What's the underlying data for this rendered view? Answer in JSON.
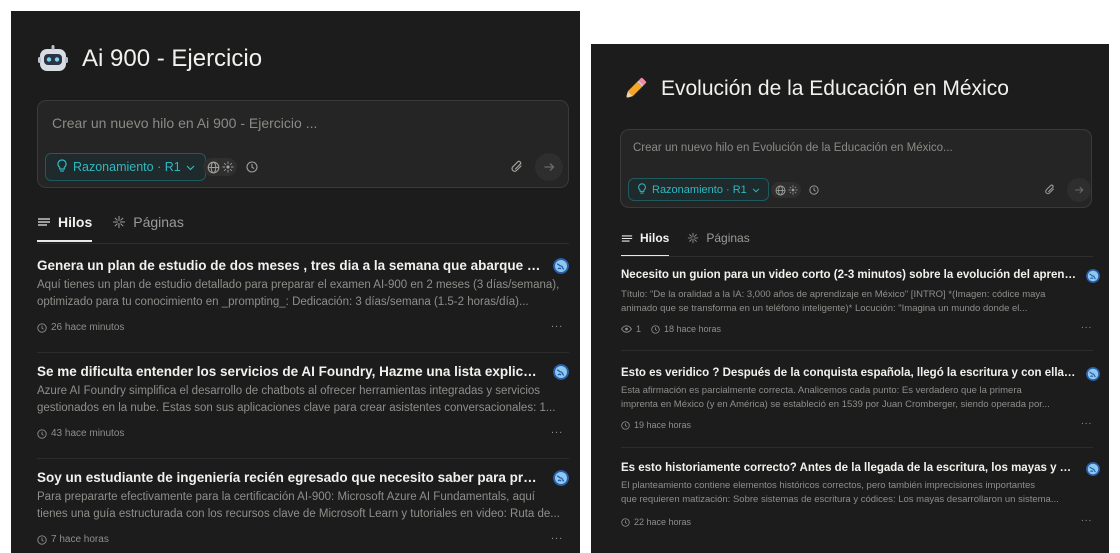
{
  "left": {
    "space_title": "Ai 900 - Ejercicio",
    "composer": {
      "placeholder": "Crear un nuevo hilo en Ai 900 - Ejercicio ...",
      "mode_label": "Razonamiento · R1"
    },
    "tabs": [
      {
        "label": "Hilos",
        "active": true
      },
      {
        "label": "Páginas",
        "active": false
      }
    ],
    "threads": [
      {
        "title": "Genera un plan de estudio de dos meses , tres dia a la semana que abarque compl...",
        "snippet_line1": "Aquí tienes un plan de estudio detallado para preparar el examen AI-900 en 2 meses (3 días/semana),",
        "snippet_line2": "optimizado para tu conocimiento en _prompting_: Dedicación: 3 días/semana (1.5-2 horas/día)...",
        "time": "26 hace minutos",
        "menu": "..."
      },
      {
        "title": "Se me dificulta entender los servicios de AI Foundry, Hazme una lista explicando d...",
        "snippet_line1": "Azure AI Foundry simplifica el desarrollo de chatbots al ofrecer herramientas integradas y servicios",
        "snippet_line2": "gestionados en la nube. Estas son sus aplicaciones clave para crear asistentes conversacionales: 1...",
        "time": "43 hace minutos",
        "menu": "..."
      },
      {
        "title": "Soy un estudiante de ingeniería recién egresado que necesito saber para prepára...",
        "snippet_line1": "Para prepararte efectivamente para la certificación AI-900: Microsoft Azure AI Fundamentals, aquí",
        "snippet_line2": "tienes una guía estructurada con los recursos clave de Microsoft Learn y tutoriales en video: Ruta de...",
        "time": "7 hace horas",
        "menu": "..."
      }
    ]
  },
  "right": {
    "space_title": "Evolución de la Educación en México",
    "composer": {
      "placeholder": "Crear un nuevo hilo en Evolución de la Educación en México...",
      "mode_label": "Razonamiento · R1"
    },
    "tabs": [
      {
        "label": "Hilos",
        "active": true
      },
      {
        "label": "Páginas",
        "active": false
      }
    ],
    "threads": [
      {
        "title": "Necesito un guion para un video corto (2-3 minutos) sobre la evolución del aprend...",
        "snippet_line1": "Título: \"De la oralidad a la IA: 3,000 años de aprendizaje en México\" [INTRO] *(Imagen: códice maya",
        "snippet_line2": "animado que se transforma en un teléfono inteligente)* Locución: \"Imagina un mundo donde el...",
        "views": "1",
        "time": "18 hace horas",
        "menu": "..."
      },
      {
        "title": "Esto es veridico ? Después de la conquista española, llegó la escritura y con ella l...",
        "snippet_line1": "Esta afirmación es parcialmente correcta. Analicemos cada punto: Es verdadero que la primera",
        "snippet_line2": "imprenta en México (y en América) se estableció en 1539 por Juan Cromberger, siendo operada por...",
        "time": "19 hace horas",
        "menu": "..."
      },
      {
        "title": "Es esto historiamente correcto? Antes de la llegada de la escritura, los mayas y az...",
        "snippet_line1": "El planteamiento contiene elementos históricos correctos, pero también imprecisiones importantes",
        "snippet_line2": "que requieren matización: Sobre sistemas de escritura y códices: Los mayas desarrollaron un sistema...",
        "time": "22 hace horas",
        "menu": "..."
      }
    ]
  },
  "colors": {
    "panel_bg": "#1c1c1c",
    "accent_teal": "#2fb8c2",
    "text_primary": "#f1f1ee",
    "text_muted": "#8e8e8a"
  },
  "icons": {
    "left_space": "robot-icon",
    "right_space": "pencil-icon",
    "web": "globe-icon",
    "sources": "sparkle-icon",
    "history": "clock-icon",
    "attach": "paperclip-icon",
    "send": "arrow-right-icon",
    "threads_tab": "lines-icon",
    "pages_tab": "sparkle-icon",
    "thread_avatar": "globe-avatar-icon",
    "views": "eye-icon"
  }
}
